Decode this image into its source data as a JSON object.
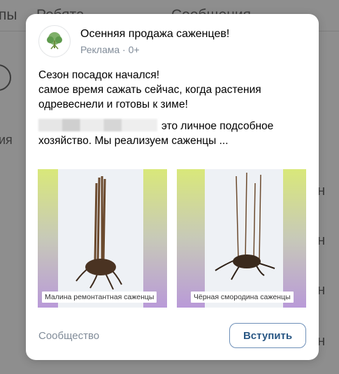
{
  "background": {
    "top_left_text": "пы",
    "top_tab_1": "Ребята",
    "top_tab_2": "Сообщения",
    "side_text": "ия",
    "right_fragments": [
      "ан",
      "ан",
      "ан",
      "ан"
    ]
  },
  "ad": {
    "title": "Осенняя продажа саженцев!",
    "meta": "Реклама · 0+",
    "avatar_icon": "tree-logo-icon",
    "text_line_1": "Сезон посадок начался!",
    "text_line_2": "самое время сажать сейчас, когда растения одревеснели и готовы к зиме!",
    "text_line_3": "это личное подсобное хозяйство. Мы реализуем саженцы ...",
    "images": [
      {
        "caption": "Малина ремонтантная саженцы"
      },
      {
        "caption": "Чёрная смородина саженцы"
      }
    ],
    "footer_label": "Сообщество",
    "join_button": "Вступить"
  },
  "colors": {
    "link": "#2a5885",
    "muted": "#818c99",
    "overlay": "#8e8e8e"
  }
}
